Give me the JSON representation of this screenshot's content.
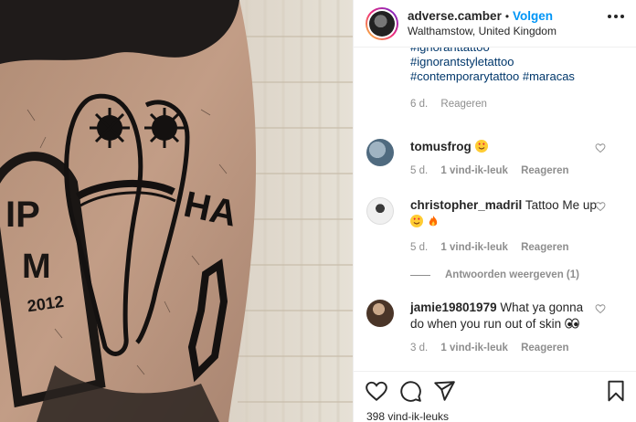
{
  "post": {
    "username": "adverse.camber",
    "separator": "•",
    "follow_label": "Volgen",
    "location": "Walthamstow, United Kingdom",
    "more_icon": "more-horizontal-icon"
  },
  "caption": {
    "hashtags": [
      "#ignoranttattoo",
      "#ignorantstyletattoo",
      "#contemporarytattoo #maracas"
    ],
    "age": "6 d.",
    "reply_label": "Reageren"
  },
  "comments": [
    {
      "username": "tomusfrog",
      "text": "",
      "emojis": [
        "heart-eyes-emoji"
      ],
      "age": "5 d.",
      "likes": "",
      "reply_label": "Reageren",
      "avatar_color": "#6b8aa3"
    },
    {
      "username": "christopher_madril",
      "text": "Tattoo Me up",
      "emojis": [
        "heart-eyes-emoji",
        "fire-emoji"
      ],
      "age": "5 d.",
      "likes": "1 vind-ik-leuk",
      "reply_label": "Reageren",
      "avatar_color": "#d9d9d9"
    },
    {
      "username": "jamie19801979",
      "text": "What ya gonna do when you run out of skin",
      "emojis": [
        "eyes-emoji"
      ],
      "age": "3 d.",
      "likes": "1 vind-ik-leuk",
      "reply_label": "Reageren",
      "avatar_color": "#5a4535"
    }
  ],
  "tomus_likes": "1 vind-ik-leuk",
  "view_replies_label": "Antwoorden weergeven (1)",
  "actions": {
    "like_icon": "heart-icon",
    "comment_icon": "comment-icon",
    "share_icon": "share-icon",
    "save_icon": "bookmark-icon",
    "likes_count": "398 vind-ik-leuks"
  },
  "photo": {
    "tattoo_text_1": "IP",
    "tattoo_text_2": "M",
    "tattoo_text_3": "2012",
    "tattoo_text_4": "HA"
  },
  "colors": {
    "accent": "#0095f6",
    "hashtag": "#00376b",
    "muted": "#8e8e8e"
  }
}
